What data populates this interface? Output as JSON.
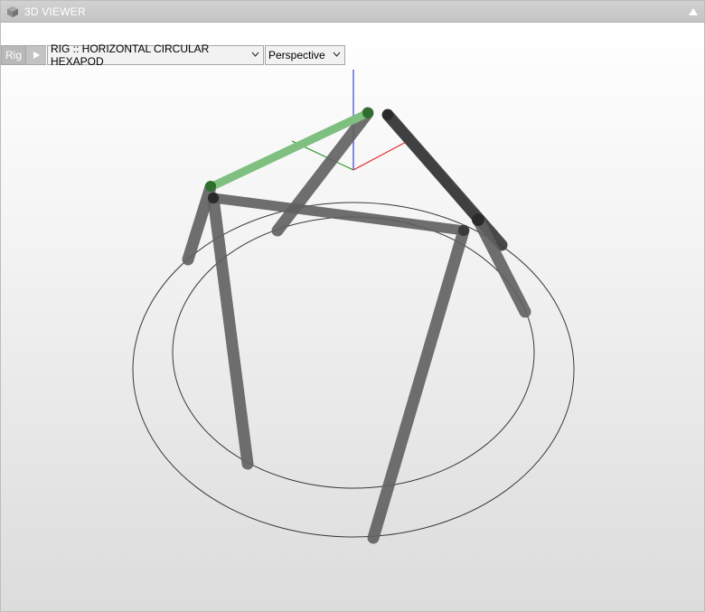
{
  "panel": {
    "title": "3D VIEWER",
    "title_icon": "cube-icon",
    "collapse_icon": "triangle-up-icon"
  },
  "toolbar": {
    "rig_label": "Rig",
    "play_icon": "play-icon",
    "rig_selected": "RIG :: HORIZONTAL CIRCULAR HEXAPOD",
    "view_selected": "Perspective",
    "dropdown_icon": "chevron-down-icon"
  },
  "colors": {
    "titlebar": "#c8c8c8",
    "title_text": "#ffffff",
    "leg": "#5f5f5f",
    "leg_dark": "#3a3a3a",
    "selected_link": "#7fbf7f",
    "selected_joint": "#2e7d32",
    "axis_x": "#e02020",
    "axis_y": "#1a8f1a",
    "axis_z": "#1a1acc"
  }
}
